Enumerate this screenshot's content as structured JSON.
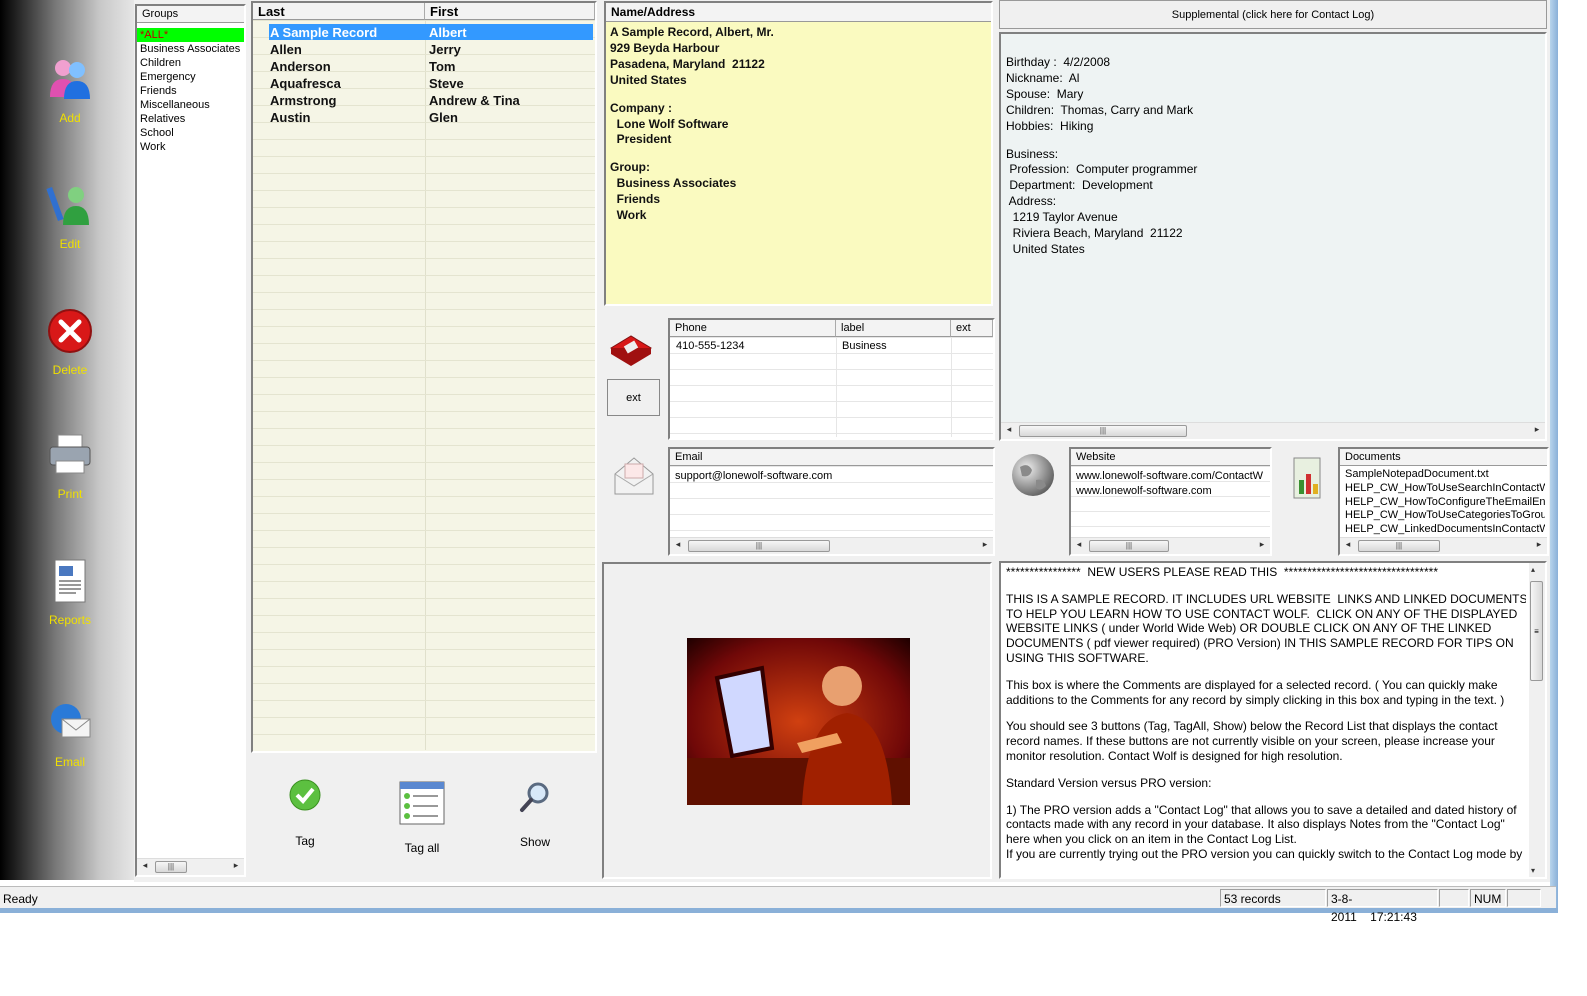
{
  "toolbar": {
    "add_label": "Add",
    "edit_label": "Edit",
    "delete_label": "Delete",
    "print_label": "Print",
    "reports_label": "Reports",
    "email_label": "Email"
  },
  "groups": {
    "header": "Groups",
    "items": [
      "*ALL*",
      "Business Associates",
      "Children",
      "Emergency",
      "Friends",
      "Miscellaneous",
      "Relatives",
      "School",
      "Work"
    ],
    "selected_color": "#00ff00"
  },
  "records": {
    "col_last": "Last",
    "col_first": "First",
    "rows": [
      {
        "last": "A Sample Record",
        "first": "Albert"
      },
      {
        "last": "Allen",
        "first": "Jerry"
      },
      {
        "last": "Anderson",
        "first": "Tom"
      },
      {
        "last": "Aquafresca",
        "first": "Steve"
      },
      {
        "last": "Armstrong",
        "first": "Andrew & Tina"
      },
      {
        "last": "Austin",
        "first": "Glen"
      }
    ],
    "selected_color": "#3399ff"
  },
  "record_buttons": {
    "tag_label": "Tag",
    "tag_all_label": "Tag all",
    "show_label": "Show"
  },
  "name_address": {
    "header": "Name/Address",
    "lines": [
      "A Sample Record, Albert, Mr.",
      "929 Beyda Harbour",
      "Pasadena, Maryland  21122",
      "United States",
      "",
      "Company :",
      "  Lone Wolf Software",
      "  President",
      "",
      "Group:",
      "  Business Associates",
      "  Friends",
      "  Work"
    ]
  },
  "supplemental": {
    "button_label": "Supplemental (click here for Contact Log)",
    "lines": [
      "Birthday :  4/2/2008",
      "Nickname:  Al",
      "Spouse:  Mary",
      "Children:  Thomas, Carry and Mark",
      "Hobbies:  Hiking",
      "",
      "Business:",
      " Profession:  Computer programmer",
      " Department:  Development",
      " Address:",
      "  1219 Taylor Avenue",
      "  Riviera Beach, Maryland  21122",
      "  United States"
    ]
  },
  "phone": {
    "col_phone": "Phone",
    "col_label": "label",
    "col_ext": "ext",
    "rows": [
      {
        "phone": "410-555-1234",
        "label": "Business",
        "ext": ""
      }
    ],
    "ext_button": "ext"
  },
  "email": {
    "header": "Email",
    "rows": [
      "support@lonewolf-software.com"
    ]
  },
  "website": {
    "header": "Website",
    "rows": [
      "www.lonewolf-software.com/ContactW",
      "www.lonewolf-software.com"
    ]
  },
  "documents": {
    "header": "Documents",
    "rows": [
      "SampleNotepadDocument.txt",
      "HELP_CW_HowToUseSearchInContactWo",
      "HELP_CW_HowToConfigureTheEmailEngi",
      "HELP_CW_HowToUseCategoriesToGroup",
      "HELP_CW_LinkedDocumentsInContactWo"
    ]
  },
  "comments": {
    "lines": [
      "****************  NEW USERS PLEASE READ THIS  *********************************",
      "",
      "THIS IS A SAMPLE RECORD. IT INCLUDES URL WEBSITE  LINKS AND LINKED DOCUMENTS",
      "TO HELP YOU LEARN HOW TO USE CONTACT WOLF.  CLICK ON ANY OF THE DISPLAYED",
      "WEBSITE LINKS ( under World Wide Web) OR DOUBLE CLICK ON ANY OF THE LINKED",
      "DOCUMENTS ( pdf viewer required) (PRO Version) IN THIS SAMPLE RECORD FOR TIPS ON",
      "USING THIS SOFTWARE.",
      "",
      "This box is where the Comments are displayed for a selected record. ( You can quickly make",
      "additions to the Comments for any record by simply clicking in this box and typing in the text. )",
      "",
      "You should see 3 buttons (Tag, TagAll, Show) below the Record List that displays the contact",
      "record names. If these buttons are not currently visible on your screen, please increase your",
      "monitor resolution. Contact Wolf is designed for high resolution.",
      "",
      "Standard Version versus PRO version:",
      "",
      "1) The PRO version adds a \"Contact Log\" that allows you to save a detailed and dated history of",
      "contacts made with any record in your database. It also displays Notes from the \"Contact Log\"",
      "here when you click on an item in the Contact Log List.",
      "If you are currently trying out the PRO version you can quickly switch to the Contact Log mode by"
    ]
  },
  "statusbar": {
    "status": "Ready",
    "records": "53 records",
    "date": "3-8-2011",
    "time": "17:21:43",
    "num": "NUM"
  }
}
